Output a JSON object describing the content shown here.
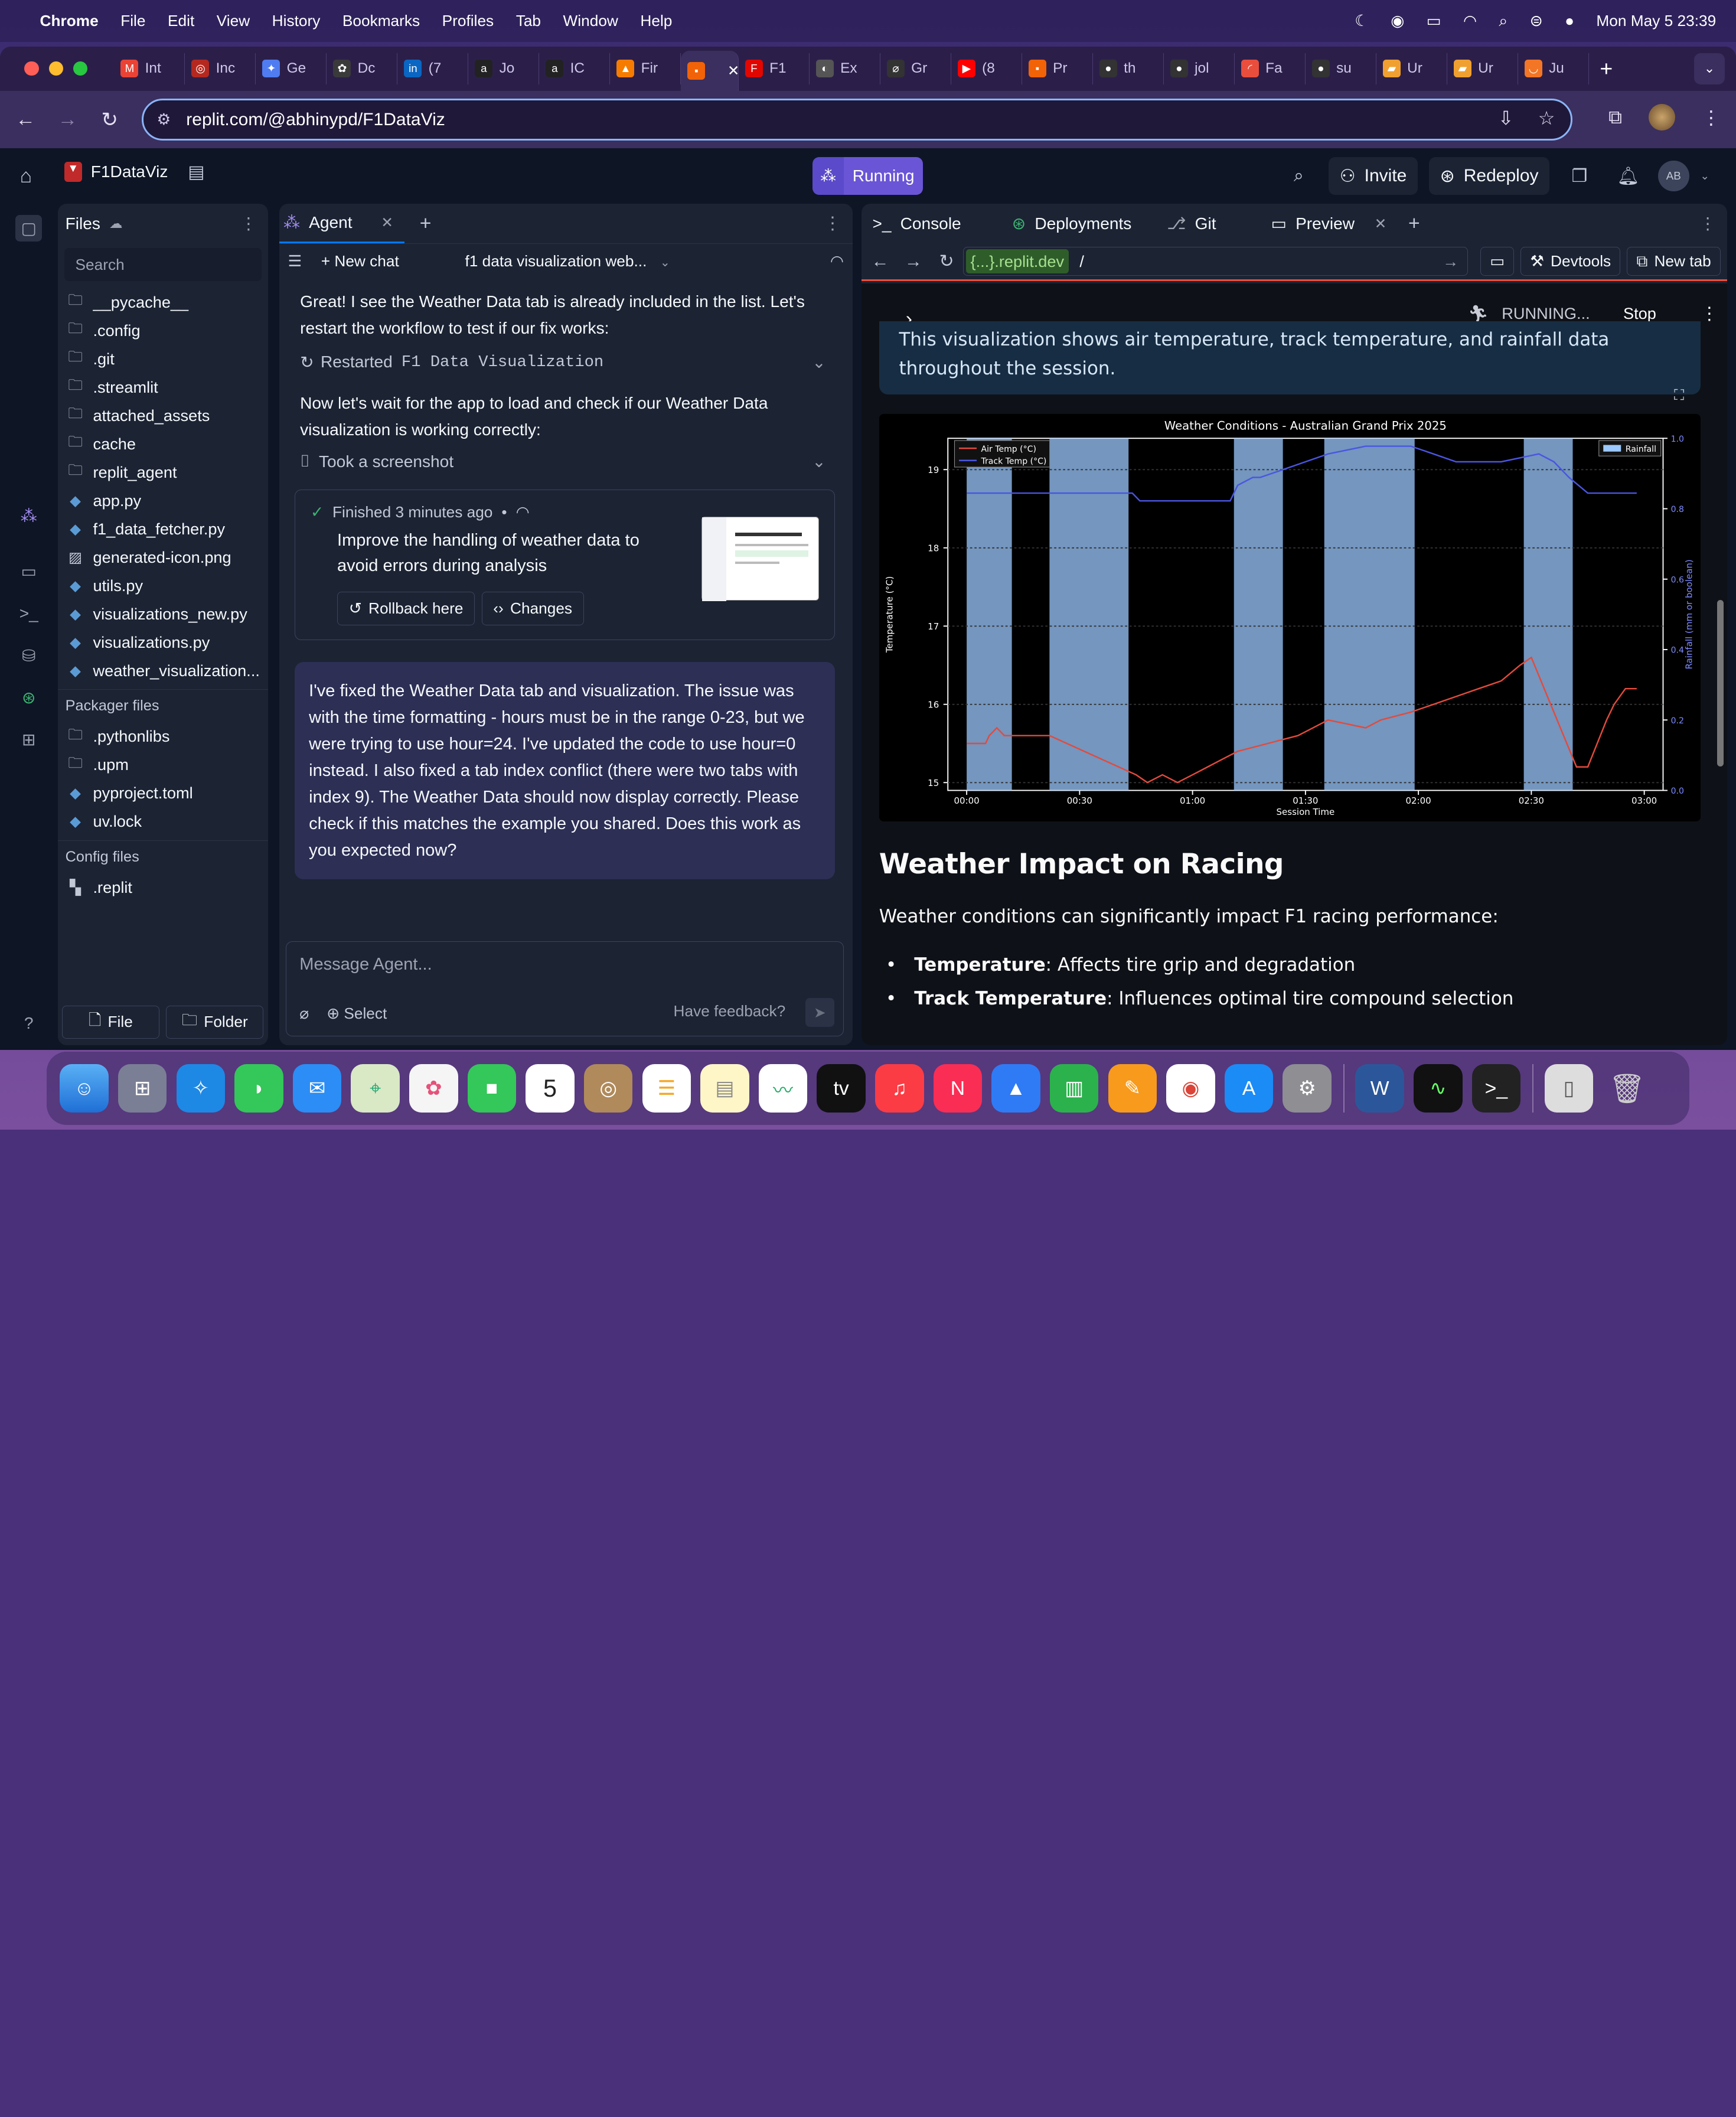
{
  "menubar": {
    "app": "Chrome",
    "items": [
      "File",
      "Edit",
      "View",
      "History",
      "Bookmarks",
      "Profiles",
      "Tab",
      "Window",
      "Help"
    ],
    "datetime": "Mon May 5  23:39"
  },
  "chrome_tabs": [
    {
      "label": "Int",
      "icon": "gmail-icon",
      "color": "#ea4335",
      "glyph": "M"
    },
    {
      "label": "Inc",
      "icon": "osu-icon",
      "color": "#b5281f",
      "glyph": "◎"
    },
    {
      "label": "Ge",
      "icon": "gemini-icon",
      "color": "#4f7cf0",
      "glyph": "✦"
    },
    {
      "label": "Dc",
      "icon": "openai-icon",
      "color": "#3a3a3a",
      "glyph": "✿"
    },
    {
      "label": "(7",
      "icon": "linkedin-icon",
      "color": "#0a66c2",
      "glyph": "in"
    },
    {
      "label": "Jo",
      "icon": "a-icon",
      "color": "#222",
      "glyph": "a"
    },
    {
      "label": "IC",
      "icon": "a-icon",
      "color": "#222",
      "glyph": "a"
    },
    {
      "label": "Fir",
      "icon": "firebase-icon",
      "color": "#f57c00",
      "glyph": "▲"
    },
    {
      "label": "",
      "icon": "replit-icon",
      "color": "#f26207",
      "glyph": "▪",
      "active": true
    },
    {
      "label": "F1",
      "icon": "f1-icon",
      "color": "#e10600",
      "glyph": "F"
    },
    {
      "label": "Ex",
      "icon": "globe-icon",
      "color": "#555",
      "glyph": "◐"
    },
    {
      "label": "Gr",
      "icon": "grok-icon",
      "color": "#333",
      "glyph": "⌀"
    },
    {
      "label": "(8",
      "icon": "youtube-icon",
      "color": "#ff0000",
      "glyph": "▶"
    },
    {
      "label": "Pr",
      "icon": "replit-icon",
      "color": "#f26207",
      "glyph": "▪"
    },
    {
      "label": "th",
      "icon": "github-icon",
      "color": "#333",
      "glyph": "●"
    },
    {
      "label": "jol",
      "icon": "github-icon",
      "color": "#333",
      "glyph": "●"
    },
    {
      "label": "Fa",
      "icon": "speed-icon",
      "color": "#e94e3c",
      "glyph": "◜"
    },
    {
      "label": "su",
      "icon": "github-icon",
      "color": "#333",
      "glyph": "●"
    },
    {
      "label": "Ur",
      "icon": "book-icon",
      "color": "#f0a030",
      "glyph": "▰"
    },
    {
      "label": "Ur",
      "icon": "book-icon",
      "color": "#f0a030",
      "glyph": "▰"
    },
    {
      "label": "Ju",
      "icon": "jupyter-icon",
      "color": "#f37626",
      "glyph": "◡"
    }
  ],
  "address": {
    "url": "replit.com/@abhinypd/F1DataViz"
  },
  "replit": {
    "project": "F1DataViz",
    "run_status": "Running",
    "invite": "Invite",
    "redeploy": "Redeploy",
    "avatar": "AB"
  },
  "files": {
    "title": "Files",
    "search_placeholder": "Search",
    "items": [
      {
        "name": "__pycache__",
        "type": "folder"
      },
      {
        "name": ".config",
        "type": "folder"
      },
      {
        "name": ".git",
        "type": "folder"
      },
      {
        "name": ".streamlit",
        "type": "folder"
      },
      {
        "name": "attached_assets",
        "type": "folder"
      },
      {
        "name": "cache",
        "type": "folder"
      },
      {
        "name": "replit_agent",
        "type": "folder"
      },
      {
        "name": "app.py",
        "type": "py"
      },
      {
        "name": "f1_data_fetcher.py",
        "type": "py"
      },
      {
        "name": "generated-icon.png",
        "type": "img"
      },
      {
        "name": "utils.py",
        "type": "py"
      },
      {
        "name": "visualizations_new.py",
        "type": "py"
      },
      {
        "name": "visualizations.py",
        "type": "py"
      },
      {
        "name": "weather_visualization...",
        "type": "py"
      }
    ],
    "packager_title": "Packager files",
    "packager": [
      {
        "name": ".pythonlibs",
        "type": "folder"
      },
      {
        "name": ".upm",
        "type": "folder"
      },
      {
        "name": "pyproject.toml",
        "type": "py"
      },
      {
        "name": "uv.lock",
        "type": "py"
      }
    ],
    "config_title": "Config files",
    "config": [
      {
        "name": ".replit",
        "type": "replit"
      }
    ],
    "new_file": "File",
    "new_folder": "Folder"
  },
  "agent": {
    "tab": "Agent",
    "new_chat": "New chat",
    "chat_title": "f1 data visualization web...",
    "msg1": "Great! I see the Weather Data tab is already included in the list. Let's restart the workflow to test if our fix works:",
    "action1_label": "Restarted",
    "action1_code": "F1 Data Visualization",
    "msg2": "Now let's wait for the app to load and check if our Weather Data visualization is working correctly:",
    "action2": "Took a screenshot",
    "card_status": "Finished 3 minutes ago",
    "card_bullet": "•",
    "card_desc": "Improve the handling of weather data to avoid errors during analysis",
    "rollback": "Rollback here",
    "changes": "Changes",
    "reply": "I've fixed the Weather Data tab and visualization. The issue was with the time formatting - hours must be in the range 0-23, but we were trying to use hour=24. I've updated the code to use hour=0 instead. I also fixed a tab index conflict (there were two tabs with index 9). The Weather Data should now display correctly. Please check if this matches the example you shared. Does this work as you expected now?",
    "composer_placeholder": "Message Agent...",
    "select": "Select",
    "feedback": "Have feedback?"
  },
  "right": {
    "tabs": [
      "Console",
      "Deployments",
      "Git",
      "Preview"
    ],
    "domain": "{...}.replit.dev",
    "path": "/",
    "devtools": "Devtools",
    "newtab": "New tab"
  },
  "app": {
    "status": "RUNNING...",
    "stop": "Stop",
    "note": "This visualization shows air temperature, track temperature, and rainfall data throughout the session.",
    "heading": "Weather Impact on Racing",
    "intro": "Weather conditions can significantly impact F1 racing performance:",
    "bullets": [
      {
        "bold": "Temperature",
        "text": ": Affects tire grip and degradation"
      },
      {
        "bold": "Track Temperature",
        "text": ": Influences optimal tire compound selection"
      }
    ]
  },
  "chart_data": {
    "type": "line",
    "title": "Weather Conditions - Australian Grand Prix 2025",
    "xlabel": "Session Time",
    "ylabel": "Temperature (°C)",
    "y2label": "Rainfall (mm or boolean)",
    "x_ticks": [
      "00:00",
      "00:30",
      "01:00",
      "01:30",
      "02:00",
      "02:30",
      "03:00"
    ],
    "y_ticks": [
      15,
      16,
      17,
      18,
      19
    ],
    "y2_ticks": [
      "0.0",
      "0.2",
      "0.4",
      "0.6",
      "0.8",
      "1.0"
    ],
    "ylim": [
      14.9,
      19.4
    ],
    "xlim_min": [
      -5,
      185
    ],
    "y2lim": [
      0,
      1.0
    ],
    "legend_left": [
      "Air Temp (°C)",
      "Track Temp (°C)"
    ],
    "legend_right": [
      "Rainfall"
    ],
    "colors": {
      "air": "#e34a3c",
      "track": "#4a55e0",
      "rain": "#9bc8ff"
    },
    "rain_intervals_min": [
      [
        0,
        12
      ],
      [
        22,
        43
      ],
      [
        71,
        84
      ],
      [
        95,
        119
      ],
      [
        148,
        161
      ]
    ],
    "air_temp": [
      [
        0,
        15.5
      ],
      [
        5,
        15.5
      ],
      [
        6,
        15.6
      ],
      [
        8,
        15.7
      ],
      [
        10,
        15.6
      ],
      [
        14,
        15.6
      ],
      [
        22,
        15.6
      ],
      [
        45,
        15.1
      ],
      [
        48,
        15.0
      ],
      [
        52,
        15.1
      ],
      [
        56,
        15.0
      ],
      [
        60,
        15.1
      ],
      [
        64,
        15.2
      ],
      [
        68,
        15.3
      ],
      [
        72,
        15.4
      ],
      [
        80,
        15.5
      ],
      [
        88,
        15.6
      ],
      [
        92,
        15.7
      ],
      [
        96,
        15.8
      ],
      [
        106,
        15.7
      ],
      [
        110,
        15.8
      ],
      [
        118,
        15.9
      ],
      [
        124,
        16.0
      ],
      [
        130,
        16.1
      ],
      [
        136,
        16.2
      ],
      [
        142,
        16.3
      ],
      [
        147,
        16.5
      ],
      [
        150,
        16.6
      ],
      [
        162,
        15.2
      ],
      [
        165,
        15.2
      ],
      [
        170,
        15.8
      ],
      [
        172,
        16.0
      ],
      [
        175,
        16.2
      ],
      [
        178,
        16.2
      ]
    ],
    "track_temp": [
      [
        0,
        18.7
      ],
      [
        5,
        18.7
      ],
      [
        10,
        18.7
      ],
      [
        20,
        18.7
      ],
      [
        30,
        18.7
      ],
      [
        40,
        18.7
      ],
      [
        44,
        18.7
      ],
      [
        46,
        18.6
      ],
      [
        48,
        18.6
      ],
      [
        70,
        18.6
      ],
      [
        72,
        18.8
      ],
      [
        76,
        18.9
      ],
      [
        78,
        18.9
      ],
      [
        84,
        19.0
      ],
      [
        90,
        19.1
      ],
      [
        96,
        19.2
      ],
      [
        106,
        19.3
      ],
      [
        112,
        19.3
      ],
      [
        118,
        19.3
      ],
      [
        124,
        19.2
      ],
      [
        130,
        19.1
      ],
      [
        142,
        19.1
      ],
      [
        152,
        19.2
      ],
      [
        156,
        19.1
      ],
      [
        160,
        18.9
      ],
      [
        165,
        18.7
      ],
      [
        178,
        18.7
      ]
    ]
  }
}
